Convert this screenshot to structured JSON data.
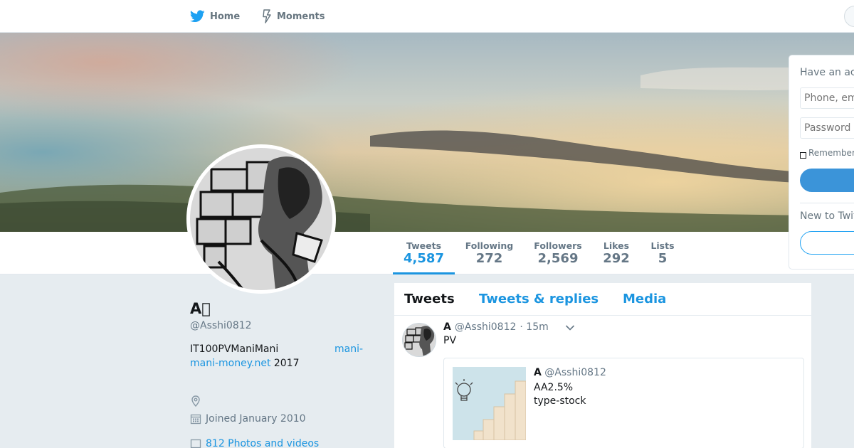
{
  "nav": {
    "home_label": "Home",
    "moments_label": "Moments"
  },
  "stats": [
    {
      "label": "Tweets",
      "value": "4,587"
    },
    {
      "label": "Following",
      "value": "272"
    },
    {
      "label": "Followers",
      "value": "2,569"
    },
    {
      "label": "Likes",
      "value": "292"
    },
    {
      "label": "Lists",
      "value": "5"
    }
  ],
  "profile": {
    "name": "A\u0000",
    "handle": "@Asshi0812",
    "bio_text": "IT100PVManiMani",
    "bio_link_part1": "mani-",
    "bio_link_part2": "mani-money.net",
    "bio_after": " 2017",
    "joined": "Joined January 2010",
    "photos": "812 Photos and videos"
  },
  "timeline": {
    "tabs": [
      "Tweets",
      "Tweets & replies",
      "Media"
    ],
    "tweet": {
      "name": "A",
      "handle": "@Asshi0812",
      "time": "· 15m",
      "text": "PV",
      "quote": {
        "name": "A",
        "handle": "@Asshi0812",
        "line1": "AA2.5%",
        "line2": "type-stock"
      }
    }
  },
  "login": {
    "title": "Have an account?",
    "phone_placeholder": "Phone, email or username",
    "password_placeholder": "Password",
    "remember": "Remember me",
    "new_to": "New to Twitter?"
  },
  "colors": {
    "accent": "#1b95e0",
    "brand": "#1da1f2",
    "background": "#e6ecf0"
  }
}
